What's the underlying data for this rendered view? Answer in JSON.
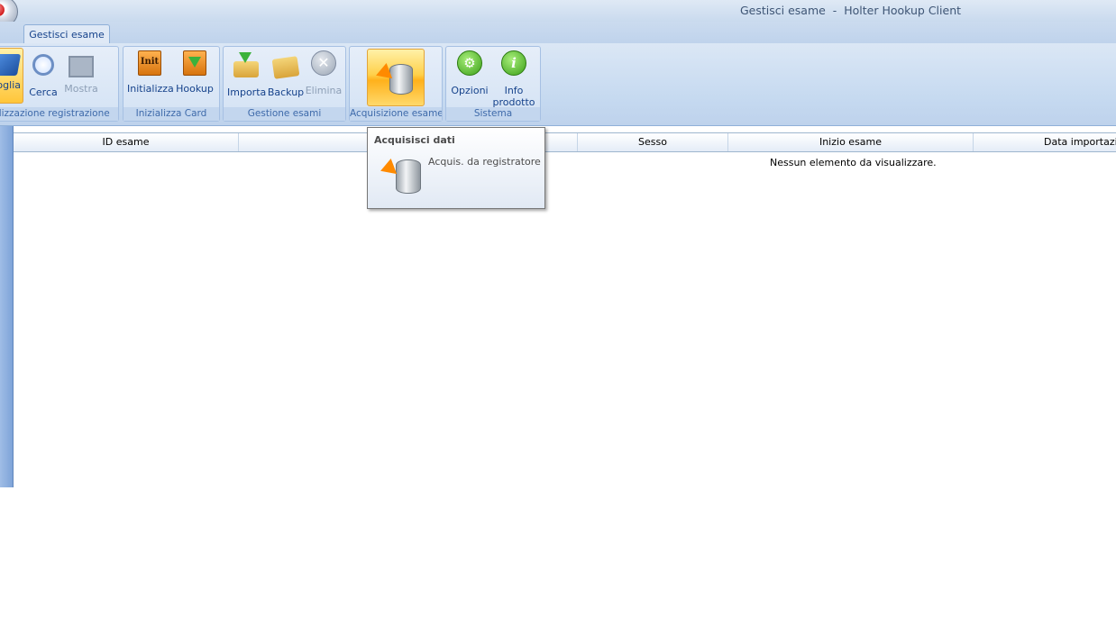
{
  "window": {
    "title": "Gestisci esame  -  Holter Hookup Client"
  },
  "tabs": [
    {
      "label": "Gestisci esame"
    }
  ],
  "ribbon": {
    "groups": [
      {
        "label": "Visualizzazione registrazione"
      },
      {
        "label": "Inizializza Card"
      },
      {
        "label": "Gestione esami"
      },
      {
        "label": "Acquisizione esame"
      },
      {
        "label": "Sistema"
      }
    ],
    "buttons": {
      "sfoglia": "Sfoglia",
      "cerca": "Cerca",
      "mostra": "Mostra",
      "inizializza": "Initializza",
      "hookup": "Hookup",
      "importa": "Importa",
      "backup": "Backup",
      "elimina": "Elimina",
      "opzioni": "Opzioni",
      "info_line1": "Info",
      "info_line2": "prodotto",
      "init_icon_text": "Init"
    }
  },
  "tooltip": {
    "title": "Acquisisci dati",
    "description": "Acquis. da registratore"
  },
  "grid": {
    "columns": [
      "ID esame",
      "",
      "Sesso",
      "Inizio esame",
      "Data importazione"
    ],
    "empty_message": "Nessun elemento da visualizzare."
  },
  "colors": {
    "ribbon_text": "#15428b",
    "highlight": "#ffd04a"
  }
}
